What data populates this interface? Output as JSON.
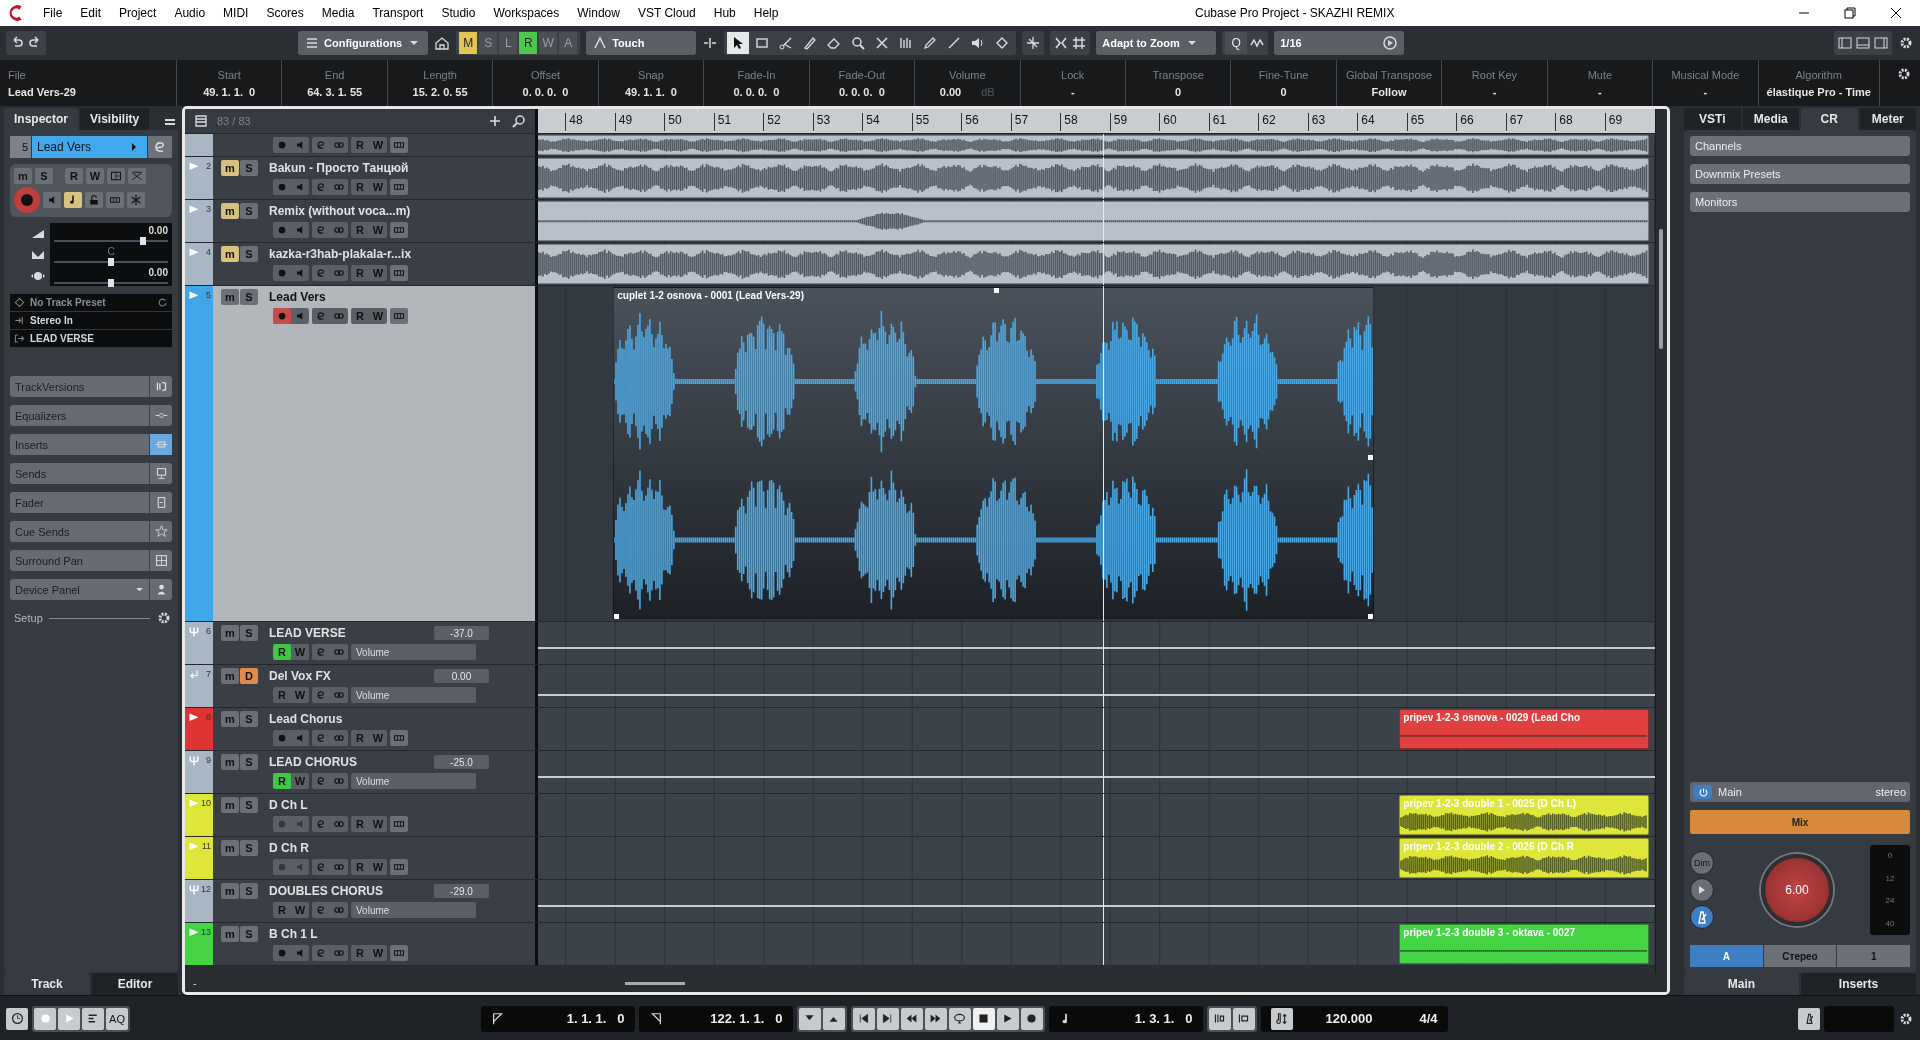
{
  "window": {
    "title": "Cubase Pro Project - SKAZHI REMIX"
  },
  "menu": [
    "File",
    "Edit",
    "Project",
    "Audio",
    "MIDI",
    "Scores",
    "Media",
    "Transport",
    "Studio",
    "Workspaces",
    "Window",
    "VST Cloud",
    "Hub",
    "Help"
  ],
  "toolbar": {
    "configurations": "Configurations",
    "automation_modes": [
      {
        "label": "M",
        "on": true,
        "color": "#e2c452"
      },
      {
        "label": "S",
        "on": false
      },
      {
        "label": "L",
        "on": false
      },
      {
        "label": "R",
        "on": true,
        "color": "#4cc94c"
      },
      {
        "label": "W",
        "on": false
      },
      {
        "label": "A",
        "on": false
      }
    ],
    "automation_mode": "Touch",
    "tools": [
      {
        "kind": "select",
        "selected": true
      },
      {
        "kind": "range",
        "selected": false
      },
      {
        "kind": "split",
        "selected": false
      },
      {
        "kind": "glue",
        "selected": false
      },
      {
        "kind": "erase",
        "selected": false
      },
      {
        "kind": "zoom",
        "selected": false
      },
      {
        "kind": "mute",
        "selected": false
      },
      {
        "kind": "warp",
        "selected": false
      },
      {
        "kind": "draw",
        "selected": false
      },
      {
        "kind": "line",
        "selected": false
      },
      {
        "kind": "play",
        "selected": false
      },
      {
        "kind": "color",
        "selected": false
      }
    ],
    "snap_type": "Adapt to Zoom",
    "quantize_label": "Q",
    "quantize": "1/16"
  },
  "info_line": [
    {
      "label": "File",
      "value": "Lead Vers-29"
    },
    {
      "label": "Start",
      "value": "49. 1. 1.  0"
    },
    {
      "label": "End",
      "value": "64. 3. 1. 55"
    },
    {
      "label": "Length",
      "value": "15. 2. 0. 55"
    },
    {
      "label": "Offset",
      "value": "0. 0. 0.  0"
    },
    {
      "label": "Snap",
      "value": "49. 1. 1.  0"
    },
    {
      "label": "Fade-In",
      "value": "0. 0. 0.  0"
    },
    {
      "label": "Fade-Out",
      "value": "0. 0. 0.  0"
    },
    {
      "label": "Volume",
      "value": "0.00",
      "unit": "dB"
    },
    {
      "label": "Lock",
      "value": "-"
    },
    {
      "label": "Transpose",
      "value": "0"
    },
    {
      "label": "Fine-Tune",
      "value": "0"
    },
    {
      "label": "Global Transpose",
      "value": "Follow"
    },
    {
      "label": "Root Key",
      "value": "-"
    },
    {
      "label": "Mute",
      "value": "-"
    },
    {
      "label": "Musical Mode",
      "value": "-"
    },
    {
      "label": "Algorithm",
      "value": "élastique Pro - Time"
    }
  ],
  "inspector": {
    "tabs": [
      {
        "label": "Inspector",
        "selected": true
      },
      {
        "label": "Visibility",
        "selected": false
      }
    ],
    "track": {
      "number": "5",
      "name": "Lead Vers",
      "mute_label": "m",
      "solo_label": "S",
      "read_label": "R",
      "write_label": "W",
      "record_armed": true,
      "volume": {
        "value": "0.00",
        "level": 0.78
      },
      "pan": {
        "value": "C",
        "level": 0.5
      },
      "delay": {
        "value": "0.00",
        "level": 0.5
      },
      "preset": "No Track Preset",
      "input": "Stereo In",
      "output": "LEAD VERSE"
    },
    "sections": [
      {
        "label": "TrackVersions",
        "kind": "versions",
        "on": false
      },
      {
        "label": "Equalizers",
        "kind": "eq",
        "on": false
      },
      {
        "label": "Inserts",
        "kind": "inserts",
        "on": true
      },
      {
        "label": "Sends",
        "kind": "sends",
        "on": false
      },
      {
        "label": "Fader",
        "kind": "fader",
        "on": false
      },
      {
        "label": "Cue Sends",
        "kind": "cue",
        "on": false
      },
      {
        "label": "Surround Pan",
        "kind": "surround",
        "on": false
      },
      {
        "label": "Device Panel",
        "kind": "device",
        "on": false
      }
    ],
    "setup": "Setup",
    "bottom_tabs": [
      {
        "label": "Track",
        "selected": true
      },
      {
        "label": "Editor",
        "selected": false
      }
    ]
  },
  "track_list": {
    "count": "83 / 83",
    "footer": "-"
  },
  "arrange": {
    "bars": [
      "48",
      "49",
      "50",
      "51",
      "52",
      "53",
      "54",
      "55",
      "56",
      "57",
      "58",
      "59",
      "60",
      "61",
      "62",
      "63",
      "64",
      "65",
      "66",
      "67",
      "68",
      "69"
    ]
  },
  "tracks": [
    {
      "kind": "audio",
      "partial": true,
      "color": "#a9b6c4",
      "selected": false,
      "record_armed": false,
      "input_disabled": false,
      "read_label": "R",
      "read_on": false,
      "write_label": "W",
      "events": [
        {
          "kind": "loop",
          "color": "#b8c0c9",
          "selected": false
        }
      ]
    },
    {
      "kind": "audio",
      "number": "2",
      "name": "Bakun - Просто Танцюй",
      "color": "#a9b6c4",
      "selected": false,
      "mute_label": "m",
      "mute_on": true,
      "solo_label": "S",
      "solo_on": false,
      "record_armed": false,
      "input_disabled": false,
      "read_label": "R",
      "read_on": false,
      "write_label": "W",
      "events": [
        {
          "kind": "loop",
          "color": "#b8c0c9",
          "selected": false
        }
      ]
    },
    {
      "kind": "audio",
      "number": "3",
      "name": "Remix (without voca...m)",
      "color": "#a9b6c4",
      "selected": false,
      "mute_label": "m",
      "mute_on": true,
      "solo_label": "S",
      "solo_on": false,
      "record_armed": false,
      "input_disabled": false,
      "read_label": "R",
      "read_on": false,
      "write_label": "W",
      "events": [
        {
          "kind": "loop-sparse",
          "color": "#b8c0c9",
          "selected": false
        }
      ]
    },
    {
      "kind": "audio",
      "number": "4",
      "name": "kazka-r3hab-plakala-r...ix",
      "color": "#a9b6c4",
      "selected": false,
      "mute_label": "m",
      "mute_on": true,
      "solo_label": "S",
      "solo_on": false,
      "record_armed": false,
      "input_disabled": false,
      "read_label": "R",
      "read_on": false,
      "write_label": "W",
      "events": [
        {
          "kind": "loop",
          "color": "#b8c0c9",
          "selected": false
        }
      ]
    },
    {
      "kind": "audio",
      "number": "5",
      "name": "Lead Vers",
      "color": "#3fa7e8",
      "selected": true,
      "expanded": true,
      "mute_label": "m",
      "mute_on": false,
      "solo_label": "S",
      "solo_on": false,
      "record_armed": true,
      "input_disabled": false,
      "read_label": "R",
      "read_on": false,
      "write_label": "W",
      "events": [
        {
          "kind": "clip",
          "name": "cuplet 1-2 osnova - 0001 (Lead Vers-29)",
          "color": "#1d2126",
          "selected": true
        }
      ]
    },
    {
      "kind": "group",
      "number": "6",
      "name": "LEAD VERSE",
      "color": "#a9b6c4",
      "selected": false,
      "mute_label": "m",
      "mute_on": false,
      "solo_label": "S",
      "solo_on": false,
      "value": "-37.0",
      "read_label": "R",
      "read_on": true,
      "write_label": "W",
      "automation_label": "Volume"
    },
    {
      "kind": "fx",
      "number": "7",
      "name": "Del Vox FX",
      "color": "#a9b6c4",
      "selected": false,
      "mute_label": "m",
      "mute_on": false,
      "solo_label": "D",
      "solo_on": true,
      "value": "0.00",
      "read_label": "R",
      "read_on": false,
      "write_label": "W",
      "automation_label": "Volume"
    },
    {
      "kind": "audio",
      "number": "8",
      "name": "Lead Chorus",
      "color": "#e03434",
      "selected": false,
      "mute_label": "m",
      "mute_on": false,
      "solo_label": "S",
      "solo_on": false,
      "record_armed": false,
      "input_disabled": false,
      "read_label": "R",
      "read_on": false,
      "write_label": "W",
      "events": [
        {
          "kind": "chorus-quiet",
          "name": "pripev 1-2-3 osnova - 0029 (Lead Cho",
          "color": "#e04040",
          "selected": false
        }
      ]
    },
    {
      "kind": "group",
      "number": "9",
      "name": "LEAD CHORUS",
      "color": "#a9b6c4",
      "selected": false,
      "mute_label": "m",
      "mute_on": false,
      "solo_label": "S",
      "solo_on": false,
      "value": "-25.0",
      "read_label": "R",
      "read_on": true,
      "write_label": "W",
      "automation_label": "Volume"
    },
    {
      "kind": "audio",
      "number": "10",
      "name": "D Ch L",
      "color": "#dde639",
      "selected": false,
      "mute_label": "m",
      "mute_on": false,
      "solo_label": "S",
      "solo_on": false,
      "record_armed": false,
      "input_disabled": true,
      "read_label": "R",
      "read_on": false,
      "write_label": "W",
      "events": [
        {
          "kind": "chorus",
          "name": "pripev 1-2-3 double 1 - 0025 (D Ch L)",
          "color": "#dde639",
          "selected": false
        }
      ]
    },
    {
      "kind": "audio",
      "number": "11",
      "name": "D Ch R",
      "color": "#dde639",
      "selected": false,
      "mute_label": "m",
      "mute_on": false,
      "solo_label": "S",
      "solo_on": false,
      "record_armed": false,
      "input_disabled": true,
      "read_label": "R",
      "read_on": false,
      "write_label": "W",
      "events": [
        {
          "kind": "chorus",
          "name": "pripev 1-2-3 double 2 - 0026 (D Ch R",
          "color": "#dde639",
          "selected": false
        }
      ]
    },
    {
      "kind": "group",
      "number": "12",
      "name": "DOUBLES CHORUS",
      "color": "#a9b6c4",
      "selected": false,
      "mute_label": "m",
      "mute_on": false,
      "solo_label": "S",
      "solo_on": false,
      "value": "-29.0",
      "read_label": "R",
      "read_on": false,
      "write_label": "W",
      "automation_label": "Volume"
    },
    {
      "kind": "audio",
      "number": "13",
      "name": "B Ch 1 L",
      "color": "#44d444",
      "selected": false,
      "mute_label": "m",
      "mute_on": false,
      "solo_label": "S",
      "solo_on": false,
      "record_armed": false,
      "input_disabled": false,
      "read_label": "R",
      "read_on": false,
      "write_label": "W",
      "events": [
        {
          "kind": "chorus-quiet",
          "name": "pripev 1-2-3 double 3 - oktava - 0027",
          "color": "#44d444",
          "selected": false
        }
      ]
    }
  ],
  "right_panel": {
    "tabs": [
      {
        "label": "VSTi",
        "selected": false
      },
      {
        "label": "Media",
        "selected": false
      },
      {
        "label": "CR",
        "selected": true
      },
      {
        "label": "Meter",
        "selected": false
      }
    ],
    "sections": [
      "Channels",
      "Downmix Presets",
      "Monitors"
    ],
    "main": {
      "label": "Main",
      "format": "stereo",
      "power_on": true
    },
    "mix": "Mix",
    "dim": "Dim",
    "knob": "6.00",
    "meter_scale": [
      "0",
      "12",
      "24",
      "40"
    ],
    "monitor_sets": [
      {
        "label": "A",
        "selected": true
      },
      {
        "label": "Стерео",
        "selected": false
      },
      {
        "label": "1",
        "selected": false
      }
    ],
    "bottom_tabs": [
      {
        "label": "Main",
        "selected": true
      },
      {
        "label": "Inserts",
        "selected": false
      }
    ]
  },
  "transport": {
    "aq": "AQ",
    "left_locator": "1. 1. 1.   0",
    "right_locator": "122. 1. 1.   0",
    "position": "1. 3. 1.   0",
    "tempo": "120.000",
    "signature": "4/4",
    "stop_on": true
  }
}
